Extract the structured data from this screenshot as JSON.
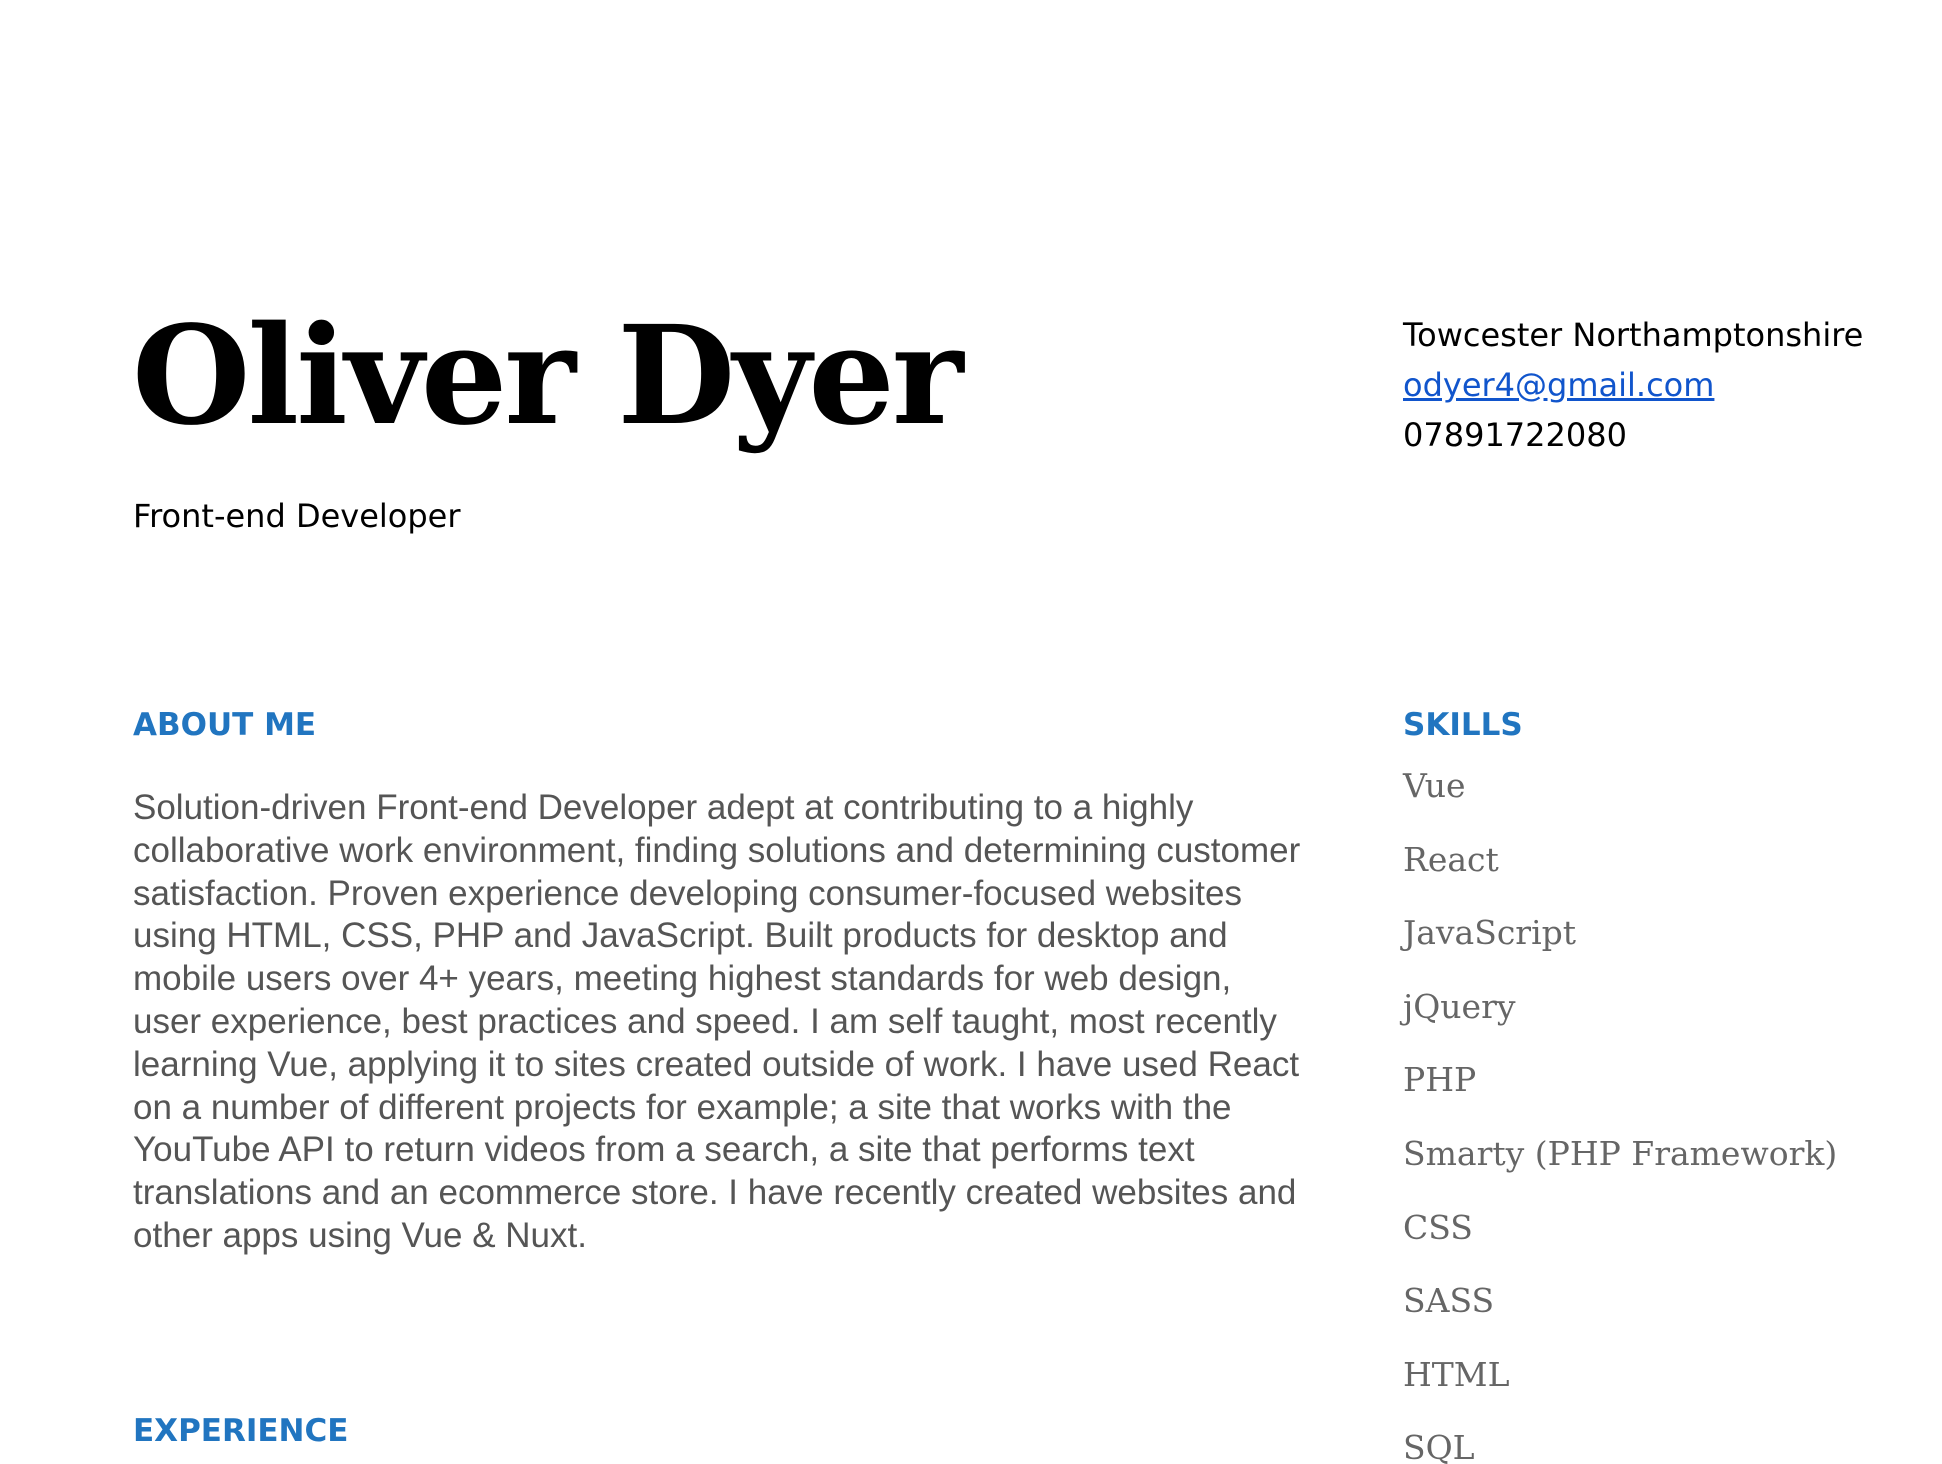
{
  "header": {
    "name": "Oliver Dyer",
    "role": "Front-end Developer"
  },
  "contact": {
    "location": "Towcester Northamptonshire",
    "email": "odyer4@gmail.com",
    "phone": "07891722080"
  },
  "about": {
    "heading": "ABOUT ME",
    "text": "Solution-driven Front-end Developer adept at contributing to a highly collaborative work environment, finding solutions and determining customer satisfaction. Proven experience developing consumer-focused websites using HTML, CSS, PHP and JavaScript. Built products for desktop and mobile users over 4+ years, meeting highest standards for web design, user experience, best practices and speed. I am self taught, most recently learning Vue, applying it to sites created outside of work. I have used React on a number of different projects for example; a site that works with the YouTube API to return videos from a search, a site that performs text translations and an ecommerce store. I have recently created websites and other apps using Vue & Nuxt."
  },
  "experience": {
    "heading": "EXPERIENCE"
  },
  "skills": {
    "heading": "SKILLS",
    "items": [
      "Vue",
      "React",
      "JavaScript",
      "jQuery",
      "PHP",
      "Smarty (PHP Framework)",
      "CSS",
      "SASS",
      "HTML",
      "SQL"
    ]
  },
  "colors": {
    "heading_accent": "#2175c0",
    "link": "#1155cc",
    "body_text": "#555555",
    "skill_text": "#666666"
  }
}
